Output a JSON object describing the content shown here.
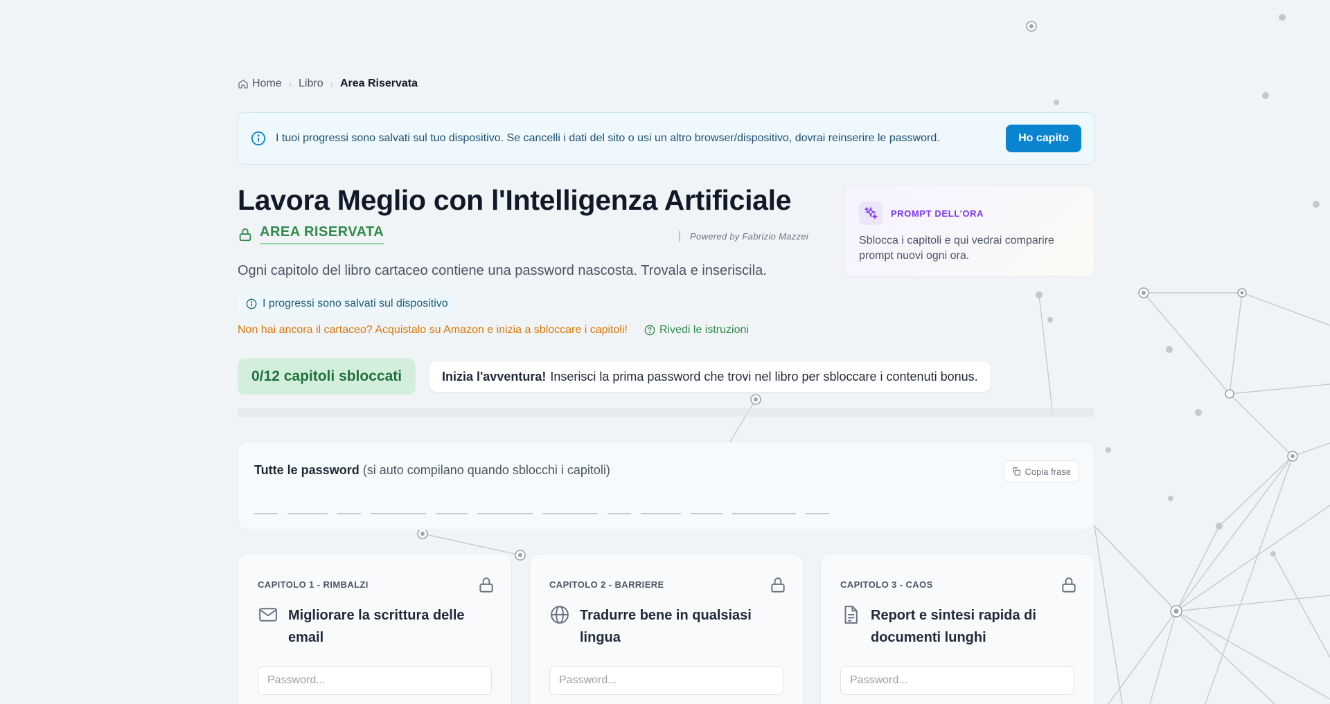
{
  "breadcrumb": {
    "home": "Home",
    "book": "Libro",
    "current": "Area Riservata"
  },
  "banner": {
    "message": "I tuoi progressi sono salvati sul tuo dispositivo. Se cancelli i dati del sito o usi un altro browser/dispositivo, dovrai reinserire le password.",
    "button": "Ho capito"
  },
  "hero": {
    "title": "Lavora Meglio con l'Intelligenza Artificiale",
    "area_label": "AREA RISERVATA",
    "powered_by": "Powered by Fabrizio Mazzei",
    "subtitle": "Ogni capitolo del libro cartaceo contiene una password nascosta. Trovala e inseriscila.",
    "saved_chip": "I progressi sono salvati sul dispositivo",
    "amazon_link": "Non hai ancora il cartaceo? Acquistalo su Amazon e inizia a sbloccare i capitoli!",
    "instructions_link": "Rivedi le istruzioni"
  },
  "prompt_card": {
    "tag": "PROMPT DELL'ORA",
    "text": "Sblocca i capitoli e qui vedrai comparire prompt nuovi ogni ora."
  },
  "progress": {
    "label": "0/12 capitoli sbloccati",
    "unlocked": 0,
    "total": 12,
    "start_bold": "Inizia l'avventura!",
    "start_text": "Inserisci la prima password che trovi nel libro per sbloccare i contenuti bonus."
  },
  "passwords_panel": {
    "title": "Tutte le password",
    "subtitle": "(si auto compilano quando sblocchi i capitoli)",
    "copy_button": "Copia frase",
    "blank_count": 12
  },
  "chapters": [
    {
      "label": "CAPITOLO 1 - RIMBALZI",
      "title": "Migliorare la scrittura delle email",
      "icon": "mail-icon",
      "placeholder": "Password...",
      "locked": true
    },
    {
      "label": "CAPITOLO 2 - BARRIERE",
      "title": "Tradurre bene in qualsiasi lingua",
      "icon": "globe-icon",
      "placeholder": "Password...",
      "locked": true
    },
    {
      "label": "CAPITOLO 3 - CAOS",
      "title": "Report e sintesi rapida di documenti lunghi",
      "icon": "document-icon",
      "placeholder": "Password...",
      "locked": true
    }
  ],
  "colors": {
    "accent_blue": "#0b84cf",
    "accent_green": "#2f8a4a",
    "accent_orange": "#d97706",
    "accent_purple": "#7c3aed"
  }
}
